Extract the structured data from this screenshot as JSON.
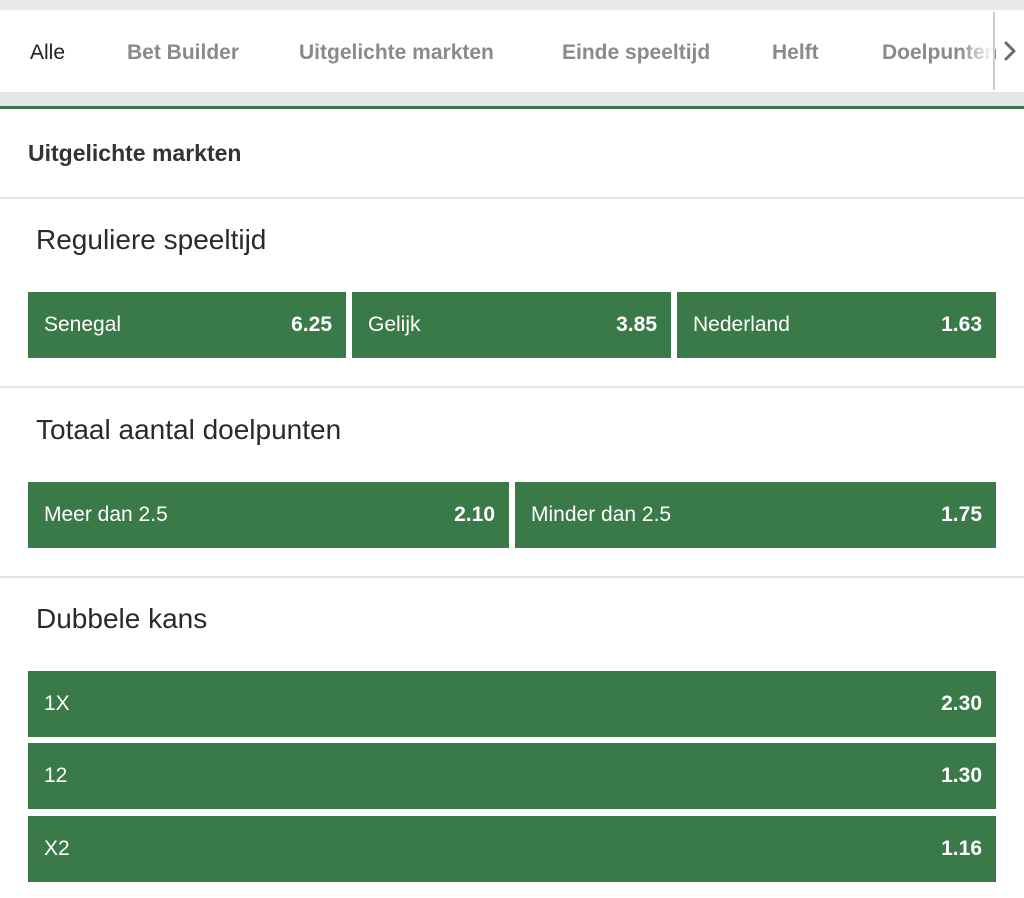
{
  "tabs": [
    {
      "label": "Alle",
      "active": true
    },
    {
      "label": "Bet Builder"
    },
    {
      "label": "Uitgelichte markten"
    },
    {
      "label": "Einde speeltijd"
    },
    {
      "label": "Helft"
    },
    {
      "label": "Doelpunten"
    }
  ],
  "section_title": "Uitgelichte markten",
  "groups": [
    {
      "title": "Reguliere speeltijd",
      "outcomes": [
        {
          "label": "Senegal",
          "odds": "6.25"
        },
        {
          "label": "Gelijk",
          "odds": "3.85"
        },
        {
          "label": "Nederland",
          "odds": "1.63"
        }
      ]
    },
    {
      "title": "Totaal aantal doelpunten",
      "outcomes": [
        {
          "label": "Meer dan 2.5",
          "odds": "2.10"
        },
        {
          "label": "Minder dan 2.5",
          "odds": "1.75"
        }
      ]
    },
    {
      "title": "Dubbele kans",
      "outcomes": [
        {
          "label": "1X",
          "odds": "2.30"
        },
        {
          "label": "12",
          "odds": "1.30"
        },
        {
          "label": "X2",
          "odds": "1.16"
        }
      ]
    }
  ],
  "colors": {
    "odds_button": "#3a7a48",
    "accent_line": "#3a7a48"
  },
  "icons": {
    "scroll_right": "chevron-right-icon"
  }
}
